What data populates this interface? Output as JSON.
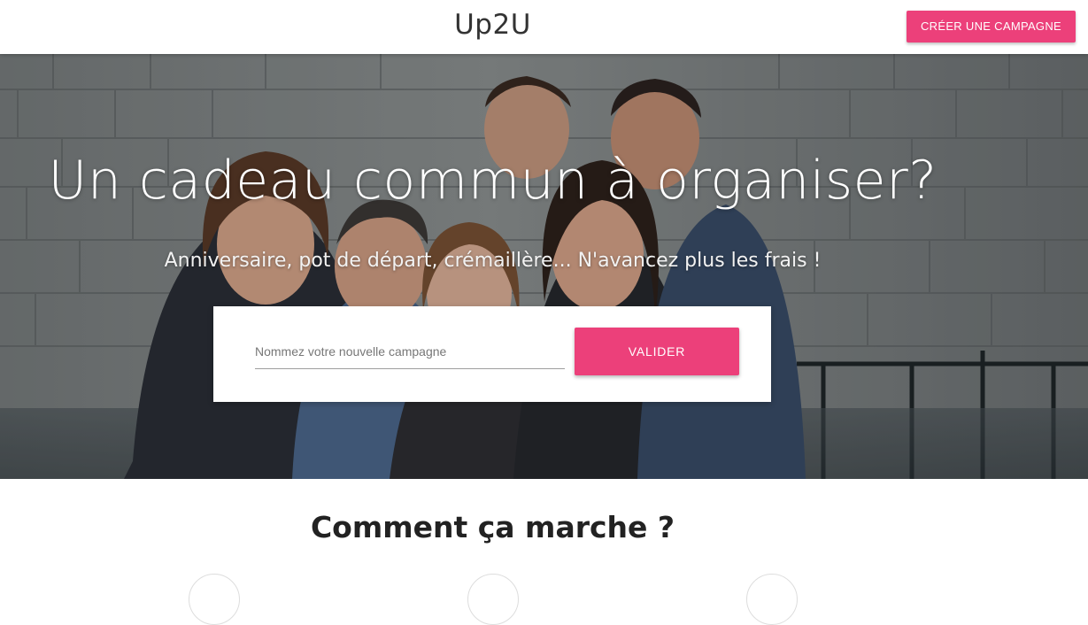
{
  "header": {
    "brand": "Up2U",
    "create_campaign_label": "CRÉER UNE CAMPAGNE"
  },
  "hero": {
    "title": "Un cadeau commun à organiser?",
    "subtitle": "Anniversaire, pot de départ, crémaillère... N'avancez plus les frais !",
    "background": "group-of-friends-photo",
    "form": {
      "input_value": "",
      "input_placeholder": "Nommez votre nouvelle campagne",
      "submit_label": "VALIDER"
    }
  },
  "how_it_works": {
    "title": "Comment ça marche ?",
    "step_icons": [
      "step-1-icon",
      "step-2-icon",
      "step-3-icon"
    ]
  },
  "colors": {
    "accent": "#ec407a",
    "header_bg": "#ffffff",
    "text": "#222222"
  }
}
